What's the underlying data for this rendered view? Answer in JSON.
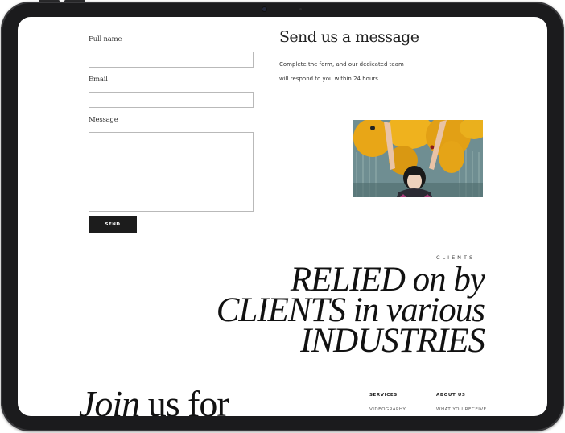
{
  "form": {
    "full_name_label": "Full name",
    "full_name_value": "",
    "email_label": "Email",
    "email_value": "",
    "message_label": "Message",
    "message_value": "",
    "send_label": "SEND"
  },
  "contact": {
    "title": "Send us a message",
    "description_line1": "Complete the form, and our dedicated team",
    "description_line2": "will respond to you within 24 hours."
  },
  "clients": {
    "eyebrow": "CLIENTS",
    "headline_line1": "RELIED on by",
    "headline_line2": "CLIENTS in various",
    "headline_line3": "INDUSTRIES"
  },
  "footer": {
    "join_italic": "Join",
    "join_rest": " us for",
    "services_heading": "SERVICES",
    "services_first": "VIDEOGRAPHY",
    "about_heading": "ABOUT US",
    "about_first": "WHAT YOU RECEIVE"
  },
  "colors": {
    "bezel": "#1b1b1d",
    "button": "#1c1c1c",
    "text": "#111111",
    "balloon": "#e8a617"
  }
}
